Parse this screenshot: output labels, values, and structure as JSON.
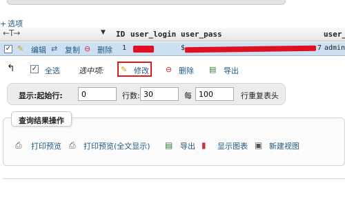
{
  "options": {
    "label": "选项"
  },
  "table": {
    "columns": [
      "ID",
      "user_login",
      "user_pass",
      "user_"
    ],
    "row": {
      "edit": "编辑",
      "copy": "复制",
      "delete": "删除",
      "id": "1",
      "login_tail": "",
      "pass_head": "$",
      "pass_tail": "7",
      "extra": "admin"
    }
  },
  "bulk": {
    "check_all": "全选",
    "selected_label": "选中项:",
    "edit": "修改",
    "delete": "删除",
    "export": "导出"
  },
  "pager": {
    "show_label": "显示:起始行:",
    "start_value": "0",
    "rows_label": "行数:",
    "rows_value": "30",
    "every_label": "每",
    "every_value": "100",
    "repeat_label": "行重复表头"
  },
  "query_ops": {
    "title": "查询结果操作",
    "items": [
      "打印预览",
      "打印预览(全文显示)",
      "导出",
      "显示图表",
      "新建视图"
    ]
  },
  "colors": {
    "link": "#235a81",
    "highlight": "#e01818",
    "row_bg": "#cde0f2"
  }
}
